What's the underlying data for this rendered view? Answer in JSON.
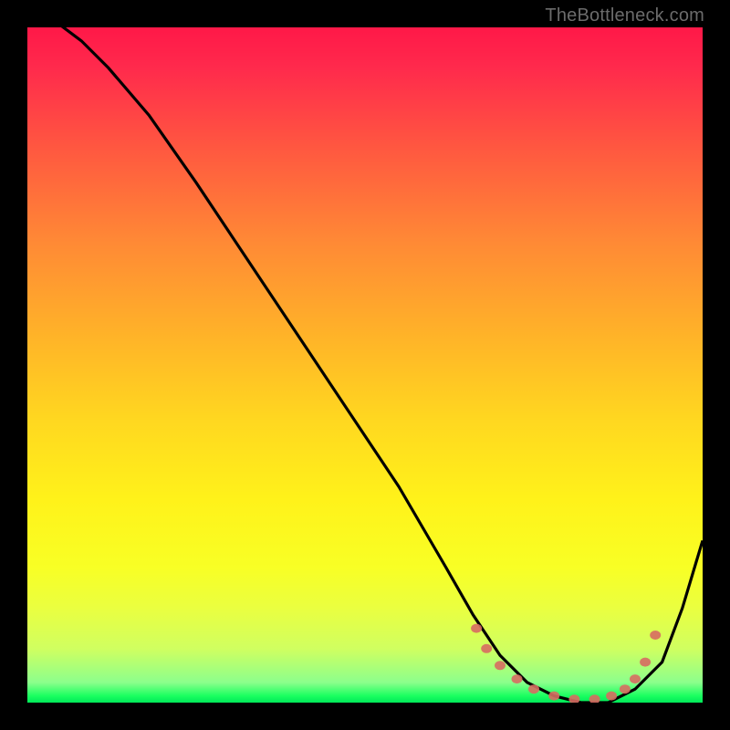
{
  "attribution": "TheBottleneck.com",
  "colors": {
    "background": "#000000",
    "gradient_top": "#ff1848",
    "gradient_bottom": "#00e858",
    "curve": "#000000",
    "markers": "#d76b62"
  },
  "chart_data": {
    "type": "line",
    "title": "",
    "xlabel": "",
    "ylabel": "",
    "xlim": [
      0,
      100
    ],
    "ylim": [
      0,
      100
    ],
    "series": [
      {
        "name": "curve",
        "x": [
          0,
          4,
          8,
          12,
          18,
          25,
          35,
          45,
          55,
          62,
          66,
          70,
          74,
          78,
          82,
          86,
          90,
          94,
          97,
          100
        ],
        "y": [
          103,
          101,
          98,
          94,
          87,
          77,
          62,
          47,
          32,
          20,
          13,
          7,
          3,
          1,
          0,
          0,
          2,
          6,
          14,
          24
        ]
      }
    ],
    "markers": [
      {
        "x": 66.5,
        "y": 11
      },
      {
        "x": 68,
        "y": 8
      },
      {
        "x": 70,
        "y": 5.5
      },
      {
        "x": 72.5,
        "y": 3.5
      },
      {
        "x": 75,
        "y": 2
      },
      {
        "x": 78,
        "y": 1
      },
      {
        "x": 81,
        "y": 0.5
      },
      {
        "x": 84,
        "y": 0.5
      },
      {
        "x": 86.5,
        "y": 1
      },
      {
        "x": 88.5,
        "y": 2
      },
      {
        "x": 90,
        "y": 3.5
      },
      {
        "x": 91.5,
        "y": 6
      },
      {
        "x": 93,
        "y": 10
      }
    ],
    "annotations": []
  }
}
